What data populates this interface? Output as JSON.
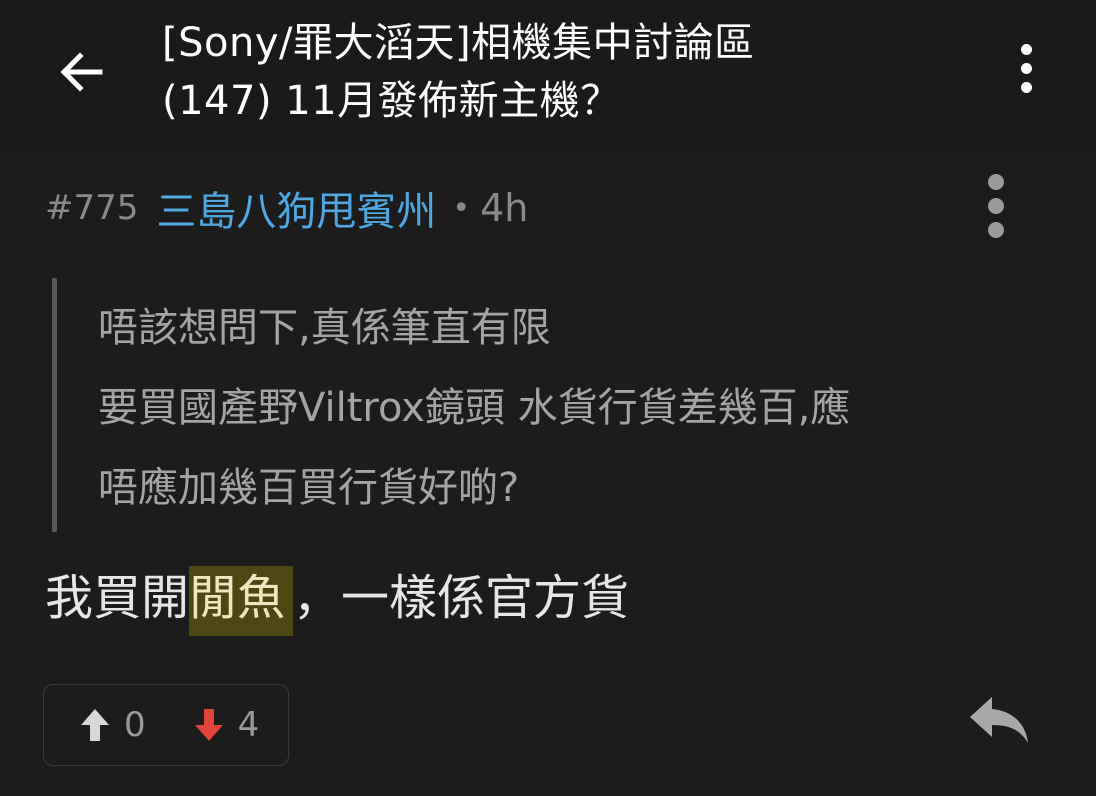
{
  "header": {
    "title_line1": "[Sony/罪大滔天]相機集中討論區",
    "title_line2": "(147) 11月發佈新主機？"
  },
  "post": {
    "number": "#775",
    "author": "三島八狗甩賓州",
    "separator": "•",
    "time": "4h",
    "quote_lines": [
      "唔該想問下,真係筆直有限",
      "要買國產野Viltrox鏡頭 水貨行貨差幾百,應",
      "唔應加幾百買行貨好啲?"
    ],
    "body_before": "我買開",
    "body_highlight": "閒魚",
    "body_after": "，一樣係官方貨",
    "upvotes": "0",
    "downvotes": "4"
  },
  "colors": {
    "background": "#1c1c1c",
    "author": "#4fa8e0",
    "downvote": "#e0443a",
    "highlight": "#4d4714"
  },
  "icons": {
    "back": "arrow-left-icon",
    "menu": "more-vertical-icon",
    "upvote": "arrow-up-icon",
    "downvote": "arrow-down-icon",
    "reply": "reply-icon"
  }
}
